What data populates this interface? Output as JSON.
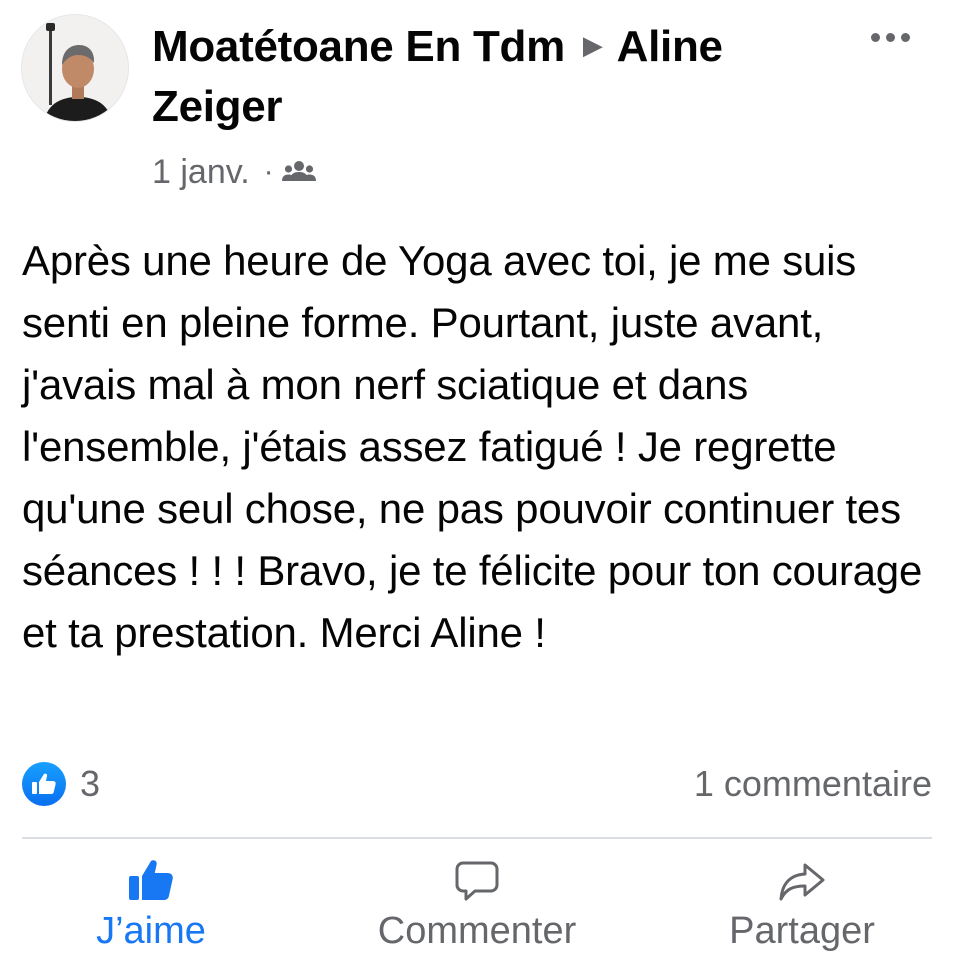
{
  "post": {
    "author": "Moatétoane En Tdm",
    "separator_icon": "triangle-right-icon",
    "recipient": "Aline Zeiger",
    "date": "1 janv.",
    "meta_dot": "·",
    "audience_icon": "group-icon",
    "more_icon": "more-horizontal-icon",
    "text": "Après une heure de Yoga avec toi, je me suis senti en pleine forme. Pourtant, juste avant, j'avais mal à mon nerf sciatique et dans l'ensemble, j'étais assez fatigué ! Je regrette qu'une seul chose, ne pas pouvoir continuer tes séances ! ! ! Bravo, je te félicite pour ton courage et ta prestation. Merci Aline !"
  },
  "reactions": {
    "icon": "like-reaction-icon",
    "count": "3"
  },
  "comments": {
    "count_label": "1 commentaire"
  },
  "actions": {
    "like": {
      "label": "J’aime",
      "icon": "thumbs-up-icon"
    },
    "comment": {
      "label": "Commenter",
      "icon": "speech-bubble-icon"
    },
    "share": {
      "label": "Partager",
      "icon": "share-arrow-icon"
    }
  },
  "colors": {
    "accent": "#1877f2",
    "text_primary": "#050505",
    "text_secondary": "#65676b",
    "divider": "#dadde1"
  }
}
